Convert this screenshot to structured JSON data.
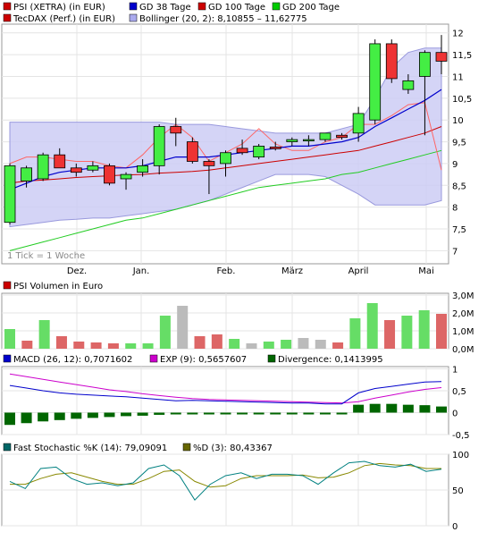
{
  "chart_data": [
    {
      "type": "candlestick",
      "legend": [
        {
          "label": "PSI (XETRA) (in EUR)",
          "color": "#cc0000"
        },
        {
          "label": "GD 38 Tage",
          "color": "#0000cc"
        },
        {
          "label": "GD 100 Tage",
          "color": "#cc0000"
        },
        {
          "label": "GD 200 Tage",
          "color": "#00cc00"
        },
        {
          "label": "TecDAX (Perf.) (in EUR)",
          "color": "#cc0000"
        },
        {
          "label": "Bollinger (20, 2): 8,10855 – 11,62775",
          "color": "#aaaaee"
        }
      ],
      "note": "1 Tick = 1 Woche",
      "y_ticks": [
        "7",
        "7,5",
        "8",
        "8,5",
        "9",
        "9,5",
        "10",
        "10,5",
        "11",
        "11,5",
        "12"
      ],
      "ylim": [
        6.7,
        12.2
      ],
      "x_ticks": [
        "Dez.",
        "Jan.",
        "Feb.",
        "März",
        "April",
        "Mai"
      ],
      "candles": [
        {
          "o": 7.65,
          "h": 9.0,
          "l": 7.6,
          "c": 8.95
        },
        {
          "o": 8.6,
          "h": 8.95,
          "l": 8.45,
          "c": 8.9
        },
        {
          "o": 8.65,
          "h": 9.25,
          "l": 8.6,
          "c": 9.2
        },
        {
          "o": 9.2,
          "h": 9.35,
          "l": 8.9,
          "c": 8.9
        },
        {
          "o": 8.9,
          "h": 9.0,
          "l": 8.7,
          "c": 8.8
        },
        {
          "o": 8.85,
          "h": 9.05,
          "l": 8.8,
          "c": 8.95
        },
        {
          "o": 8.95,
          "h": 9.0,
          "l": 8.5,
          "c": 8.55
        },
        {
          "o": 8.65,
          "h": 8.8,
          "l": 8.4,
          "c": 8.75
        },
        {
          "o": 8.8,
          "h": 9.1,
          "l": 8.7,
          "c": 8.95
        },
        {
          "o": 8.95,
          "h": 9.9,
          "l": 8.75,
          "c": 9.85
        },
        {
          "o": 9.85,
          "h": 10.05,
          "l": 9.4,
          "c": 9.7
        },
        {
          "o": 9.5,
          "h": 9.6,
          "l": 9.0,
          "c": 9.05
        },
        {
          "o": 9.05,
          "h": 9.1,
          "l": 8.3,
          "c": 8.95
        },
        {
          "o": 9.0,
          "h": 9.3,
          "l": 8.7,
          "c": 9.25
        },
        {
          "o": 9.35,
          "h": 9.55,
          "l": 9.2,
          "c": 9.25
        },
        {
          "o": 9.15,
          "h": 9.45,
          "l": 9.1,
          "c": 9.4
        },
        {
          "o": 9.38,
          "h": 9.5,
          "l": 9.3,
          "c": 9.34
        },
        {
          "o": 9.5,
          "h": 9.6,
          "l": 9.4,
          "c": 9.55
        },
        {
          "o": 9.55,
          "h": 9.65,
          "l": 9.4,
          "c": 9.55
        },
        {
          "o": 9.55,
          "h": 9.7,
          "l": 9.5,
          "c": 9.7
        },
        {
          "o": 9.65,
          "h": 9.7,
          "l": 9.55,
          "c": 9.6
        },
        {
          "o": 9.7,
          "h": 10.3,
          "l": 9.5,
          "c": 10.15
        },
        {
          "o": 10.0,
          "h": 11.85,
          "l": 9.9,
          "c": 11.75
        },
        {
          "o": 11.75,
          "h": 11.85,
          "l": 10.85,
          "c": 10.95
        },
        {
          "o": 10.7,
          "h": 11.05,
          "l": 10.6,
          "c": 10.9
        },
        {
          "o": 11.0,
          "h": 11.6,
          "l": 9.65,
          "c": 11.55
        },
        {
          "o": 11.55,
          "h": 11.95,
          "l": 11.05,
          "c": 11.35
        }
      ],
      "gd38": [
        8.4,
        8.55,
        8.7,
        8.8,
        8.85,
        8.9,
        8.9,
        8.9,
        8.95,
        9.05,
        9.15,
        9.15,
        9.15,
        9.2,
        9.25,
        9.3,
        9.35,
        9.4,
        9.4,
        9.45,
        9.5,
        9.6,
        9.85,
        10.05,
        10.25,
        10.45,
        10.7
      ],
      "gd100": [
        8.55,
        8.6,
        8.62,
        8.65,
        8.68,
        8.7,
        8.72,
        8.74,
        8.75,
        8.78,
        8.8,
        8.82,
        8.85,
        8.9,
        8.95,
        9.0,
        9.05,
        9.1,
        9.15,
        9.2,
        9.25,
        9.3,
        9.4,
        9.5,
        9.6,
        9.7,
        9.85
      ],
      "gd200": [
        7.0,
        7.1,
        7.2,
        7.3,
        7.4,
        7.5,
        7.6,
        7.7,
        7.75,
        7.85,
        7.95,
        8.05,
        8.15,
        8.25,
        8.35,
        8.45,
        8.5,
        8.55,
        8.6,
        8.65,
        8.75,
        8.8,
        8.9,
        9.0,
        9.1,
        9.2,
        9.3
      ],
      "tecdax": [
        9.0,
        9.15,
        9.15,
        9.1,
        9.05,
        9.05,
        8.95,
        8.9,
        9.2,
        9.6,
        9.9,
        9.6,
        9.05,
        9.25,
        9.45,
        9.8,
        9.45,
        9.3,
        9.3,
        9.5,
        9.6,
        9.9,
        9.9,
        10.1,
        10.35,
        10.4,
        8.85
      ],
      "boll_upper": [
        9.95,
        9.95,
        9.95,
        9.95,
        9.95,
        9.95,
        9.95,
        9.95,
        9.95,
        9.95,
        9.9,
        9.9,
        9.9,
        9.85,
        9.8,
        9.75,
        9.7,
        9.7,
        9.7,
        9.7,
        9.8,
        9.9,
        10.5,
        11.2,
        11.55,
        11.65,
        11.65
      ],
      "boll_lower": [
        7.55,
        7.6,
        7.65,
        7.7,
        7.72,
        7.75,
        7.75,
        7.8,
        7.85,
        7.9,
        7.95,
        8.05,
        8.15,
        8.3,
        8.45,
        8.6,
        8.75,
        8.75,
        8.75,
        8.7,
        8.5,
        8.3,
        8.05,
        8.05,
        8.05,
        8.05,
        8.15
      ]
    },
    {
      "type": "bar",
      "legend": [
        {
          "label": "PSI Volumen in Euro",
          "color": "#cc0000"
        }
      ],
      "y_ticks": [
        "0,0M",
        "1,0M",
        "2,0M",
        "3,0M"
      ],
      "ylim": [
        0,
        3.0
      ],
      "values": [
        1.1,
        0.45,
        1.6,
        0.7,
        0.4,
        0.35,
        0.3,
        0.3,
        0.3,
        1.85,
        2.4,
        0.7,
        0.8,
        0.55,
        0.3,
        0.4,
        0.5,
        0.6,
        0.5,
        0.35,
        1.7,
        2.55,
        1.6,
        1.85,
        2.15,
        1.95
      ],
      "colors": [
        "#66dd66",
        "#dd6666",
        "#66dd66",
        "#dd6666",
        "#dd6666",
        "#dd6666",
        "#dd6666",
        "#66dd66",
        "#66dd66",
        "#66dd66",
        "#bbbbbb",
        "#dd6666",
        "#dd6666",
        "#66dd66",
        "#bbbbbb",
        "#66dd66",
        "#66dd66",
        "#bbbbbb",
        "#bbbbbb",
        "#dd6666",
        "#66dd66",
        "#66dd66",
        "#dd6666",
        "#66dd66",
        "#66dd66",
        "#dd6666"
      ]
    },
    {
      "type": "line",
      "legend": [
        {
          "label": "MACD (26, 12): 0,7071602",
          "color": "#0000cc"
        },
        {
          "label": "EXP (9): 0,5657607",
          "color": "#cc00cc"
        },
        {
          "label": "Divergence: 0,1413995",
          "color": "#006600"
        }
      ],
      "y_ticks": [
        "-0,5",
        "0",
        "0,5",
        "1"
      ],
      "ylim": [
        -0.5,
        1.05
      ],
      "macd": [
        0.62,
        0.56,
        0.5,
        0.45,
        0.42,
        0.4,
        0.38,
        0.36,
        0.33,
        0.3,
        0.27,
        0.28,
        0.27,
        0.26,
        0.25,
        0.24,
        0.23,
        0.22,
        0.22,
        0.2,
        0.2,
        0.45,
        0.55,
        0.6,
        0.65,
        0.7,
        0.71
      ],
      "exp": [
        0.88,
        0.82,
        0.76,
        0.7,
        0.64,
        0.58,
        0.52,
        0.48,
        0.43,
        0.39,
        0.35,
        0.32,
        0.3,
        0.29,
        0.28,
        0.27,
        0.26,
        0.25,
        0.24,
        0.23,
        0.22,
        0.25,
        0.33,
        0.4,
        0.47,
        0.53,
        0.57
      ],
      "divergence": [
        -0.28,
        -0.24,
        -0.2,
        -0.17,
        -0.14,
        -0.12,
        -0.1,
        -0.08,
        -0.07,
        -0.05,
        -0.04,
        -0.03,
        -0.03,
        -0.03,
        -0.03,
        -0.03,
        -0.03,
        -0.03,
        -0.02,
        -0.02,
        -0.02,
        0.18,
        0.2,
        0.2,
        0.18,
        0.17,
        0.14
      ]
    },
    {
      "type": "line",
      "legend": [
        {
          "label": "Fast Stochastic %K (14): 79,09091",
          "color": "#006666"
        },
        {
          "label": "%D (3): 80,43367",
          "color": "#666600"
        }
      ],
      "y_ticks": [
        "0",
        "50",
        "100"
      ],
      "ylim": [
        0,
        100
      ],
      "k": [
        62,
        52,
        80,
        82,
        66,
        58,
        60,
        56,
        60,
        80,
        85,
        70,
        36,
        58,
        70,
        74,
        66,
        72,
        72,
        70,
        58,
        74,
        88,
        90,
        84,
        82,
        86,
        76,
        79
      ],
      "d": [
        58,
        58,
        66,
        72,
        74,
        68,
        62,
        58,
        58,
        66,
        76,
        78,
        62,
        54,
        56,
        66,
        70,
        70,
        70,
        71,
        67,
        68,
        74,
        84,
        87,
        85,
        84,
        80,
        80
      ]
    }
  ]
}
